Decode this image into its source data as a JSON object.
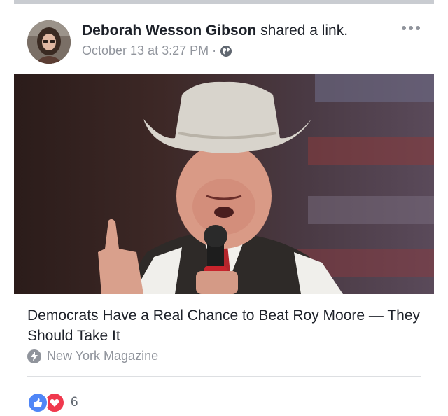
{
  "post": {
    "author": "Deborah Wesson Gibson",
    "action": "shared a link.",
    "timestamp": "October 13 at 3:27 PM",
    "separator": "·",
    "privacy_icon": "globe-icon",
    "menu_icon": "more-icon"
  },
  "link": {
    "title": "Democrats Have a Real Chance to Beat Roy Moore — They Should Take It",
    "source": "New York Magazine",
    "source_icon": "bolt-icon"
  },
  "reactions": {
    "types": [
      "like",
      "love"
    ],
    "count": "6"
  },
  "colors": {
    "name": "#1d2129",
    "meta": "#90949c",
    "like": "#4f86f7",
    "love": "#f0394e"
  }
}
